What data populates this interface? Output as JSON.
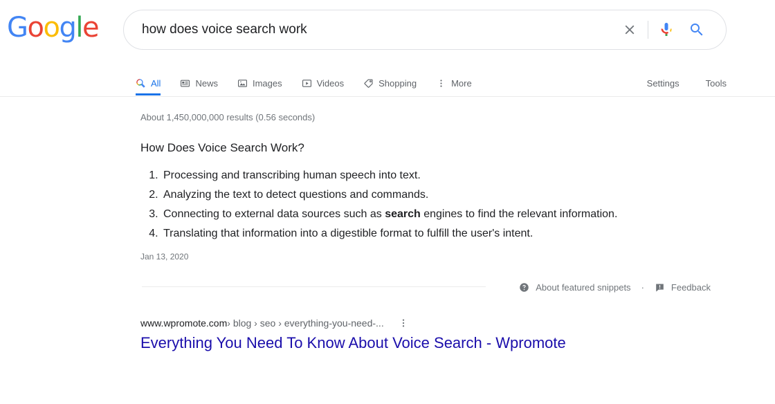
{
  "brand": {
    "logo_text": "Google",
    "logo_letters": [
      {
        "char": "G",
        "color": "#4285F4"
      },
      {
        "char": "o",
        "color": "#EA4335"
      },
      {
        "char": "o",
        "color": "#FBBC05"
      },
      {
        "char": "g",
        "color": "#4285F4"
      },
      {
        "char": "l",
        "color": "#34A853"
      },
      {
        "char": "e",
        "color": "#EA4335"
      }
    ],
    "accent_blue": "#1a73e8",
    "link_blue": "#1a0dab"
  },
  "search": {
    "query": "how does voice search work",
    "placeholder": "Search",
    "clear_icon": "close-icon",
    "voice_icon": "microphone-icon",
    "submit_icon": "search-icon"
  },
  "nav": {
    "tabs": [
      {
        "label": "All",
        "icon": "search-icon",
        "active": true
      },
      {
        "label": "News",
        "icon": "news-icon",
        "active": false
      },
      {
        "label": "Images",
        "icon": "image-icon",
        "active": false
      },
      {
        "label": "Videos",
        "icon": "video-icon",
        "active": false
      },
      {
        "label": "Shopping",
        "icon": "tag-icon",
        "active": false
      },
      {
        "label": "More",
        "icon": "more-vertical-icon",
        "active": false
      }
    ],
    "settings_label": "Settings",
    "tools_label": "Tools"
  },
  "results": {
    "stats": "About 1,450,000,000 results (0.56 seconds)",
    "featured_snippet": {
      "title": "How Does Voice Search Work?",
      "items": [
        {
          "text_before": "Processing and transcribing human speech into text.",
          "bold": "",
          "text_after": ""
        },
        {
          "text_before": "Analyzing the text to detect questions and commands.",
          "bold": "",
          "text_after": ""
        },
        {
          "text_before": "Connecting to external data sources such as ",
          "bold": "search",
          "text_after": " engines to find the relevant information."
        },
        {
          "text_before": "Translating that information into a digestible format to fulfill the user's intent.",
          "bold": "",
          "text_after": ""
        }
      ],
      "date": "Jan 13, 2020",
      "source_domain": "www.wpromote.com",
      "source_path": " › blog › seo › everything-you-need-...",
      "source_menu_icon": "more-vertical-icon",
      "source_title": "Everything You Need To Know About Voice Search - Wpromote"
    },
    "footer": {
      "about_icon": "help-circle-icon",
      "about_label": "About featured snippets",
      "separator": "·",
      "feedback_icon": "feedback-flag-icon",
      "feedback_label": "Feedback"
    }
  }
}
